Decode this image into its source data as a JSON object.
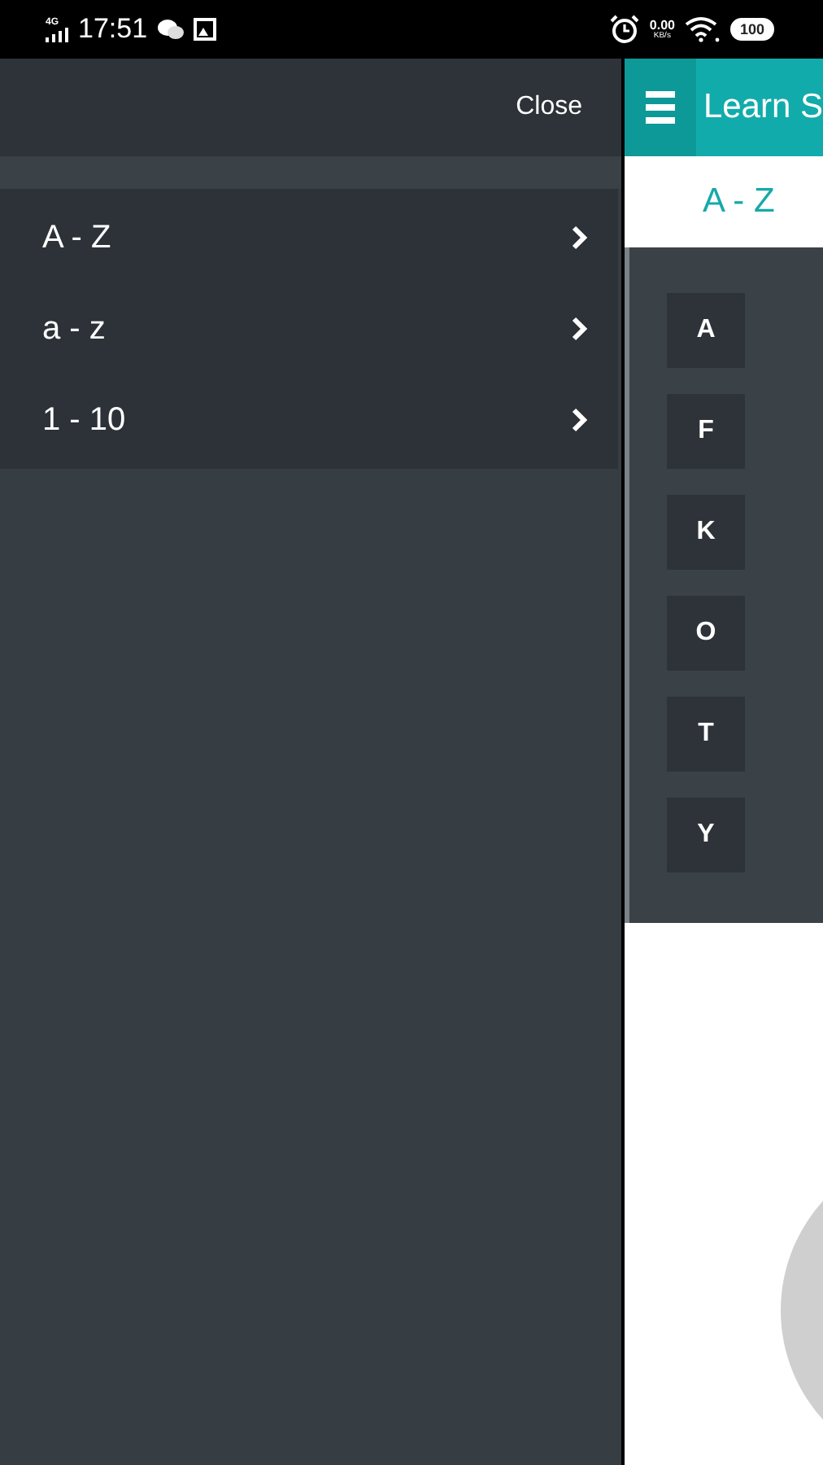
{
  "status_bar": {
    "network": "4G",
    "time": "17:51",
    "speed": "0.00",
    "speed_unit": "KB/s",
    "battery": "100"
  },
  "drawer": {
    "close_label": "Close",
    "items": [
      {
        "label": "A - Z"
      },
      {
        "label": "a - z"
      },
      {
        "label": "1 - 10"
      }
    ]
  },
  "app_bar": {
    "title": "Learn S"
  },
  "section_title": "A - Z",
  "letters": [
    "A",
    "F",
    "K",
    "O",
    "T",
    "Y"
  ]
}
